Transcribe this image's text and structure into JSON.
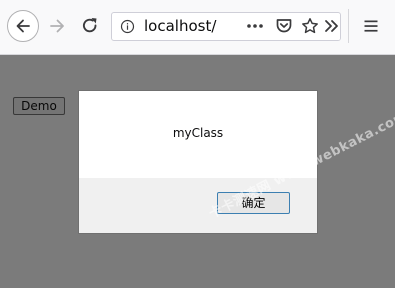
{
  "browser": {
    "url": "localhost/",
    "icons": {
      "back": "back-arrow-icon",
      "forward": "forward-arrow-icon",
      "reload": "reload-icon",
      "site_info": "site-info-icon",
      "page_actions": "more-actions-icon",
      "pocket": "pocket-icon",
      "bookmark": "bookmark-star-icon",
      "overflow": "overflow-chevron-icon",
      "menu": "hamburger-menu-icon"
    }
  },
  "page": {
    "demo_button_label": "Demo"
  },
  "dialog": {
    "message": "myClass",
    "ok_label": "确定"
  },
  "watermark": {
    "text": "卡卡测速网 www.webkaka.com"
  },
  "colors": {
    "overlay": "#808080",
    "dialog_footer": "#f0f0f0",
    "ok_button_border": "#3c7fb1",
    "toolbar_bg": "#f9f9fa"
  }
}
